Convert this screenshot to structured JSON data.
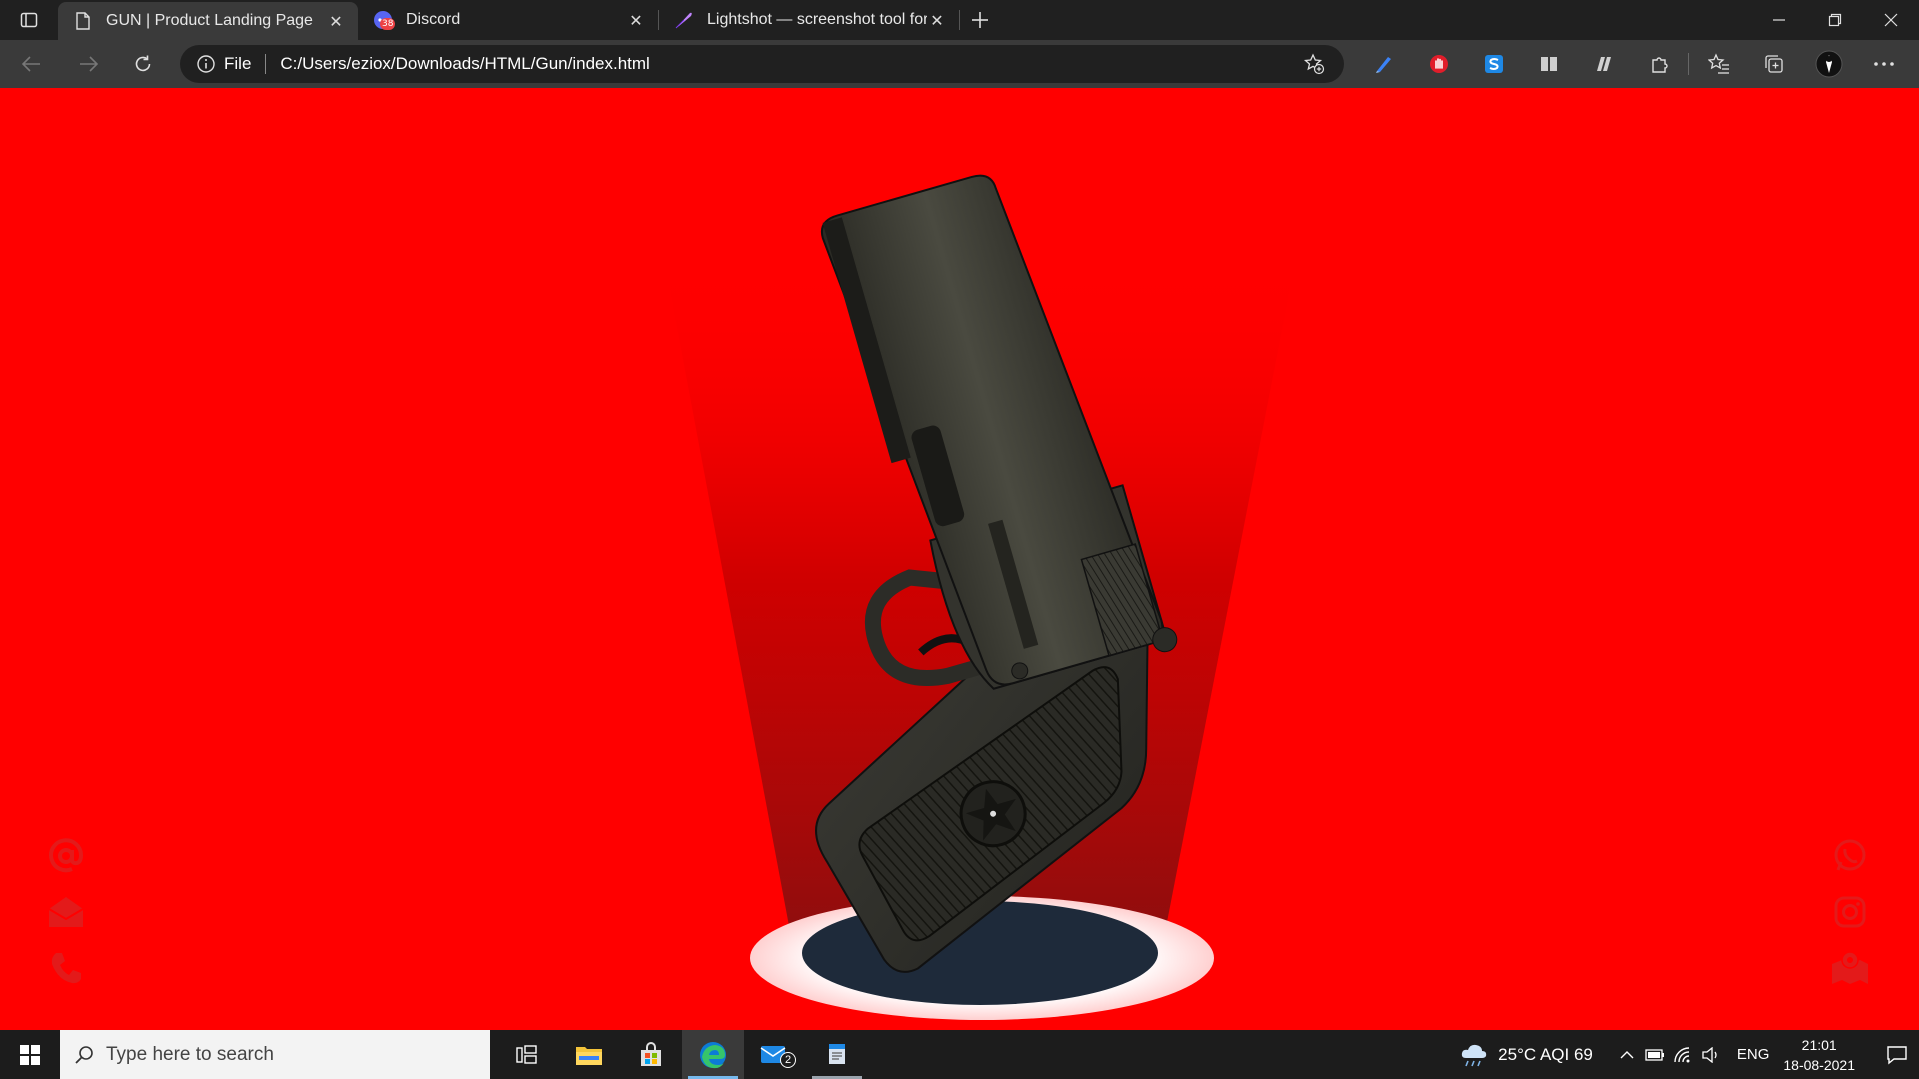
{
  "browser": {
    "tabs": [
      {
        "title": "GUN | Product Landing Page",
        "icon": "page-icon",
        "active": true
      },
      {
        "title": "Discord",
        "icon": "discord-icon",
        "badge": "38",
        "active": false
      },
      {
        "title": "Lightshot — screenshot tool for Mac & Win",
        "icon": "lightshot-feather-icon",
        "active": false
      }
    ],
    "address": {
      "site_info_label": "File",
      "url": "C:/Users/eziox/Downloads/HTML/Gun/index.html"
    }
  },
  "colors": {
    "page_background": "#ff0000",
    "spotlight_base": "#1e2a3a",
    "spotlight_ring": "#ffffff",
    "chrome_dark": "#202020",
    "chrome_toolbar": "#3a3a3a",
    "edge_accent": "#76b9ed"
  },
  "page": {
    "left_icons": [
      "at-sign-icon",
      "envelope-icon",
      "phone-icon"
    ],
    "right_icons": [
      "whatsapp-icon",
      "instagram-icon",
      "map-location-icon"
    ]
  },
  "taskbar": {
    "search_placeholder": "Type here to search",
    "mail_badge": "2",
    "weather": "25°C  AQI 69",
    "language": "ENG",
    "time": "21:01",
    "date": "18-08-2021"
  }
}
